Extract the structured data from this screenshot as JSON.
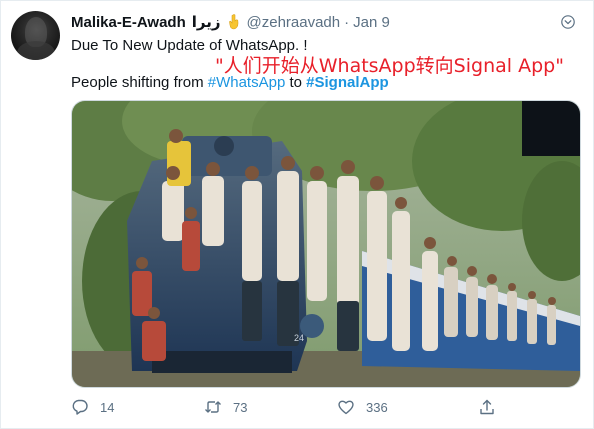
{
  "tweet": {
    "author_name": "Malika-E-Awadh",
    "author_name_urdu": "زیرا",
    "handle": "@zehraavadh",
    "separator": "·",
    "date": "Jan 9",
    "line1": "Due To New Update of WhatsApp. !",
    "annotation": "\"人们开始从WhatsApp转向Signal App\"",
    "line2_prefix": "People shifting from ",
    "hashtag1": "#WhatsApp",
    "line2_mid": " to ",
    "hashtag2": "#SignalApp"
  },
  "actions": {
    "reply_count": "14",
    "retweet_count": "73",
    "like_count": "336"
  },
  "icons": {
    "header": [
      "hand-icon",
      "chevron-down-icon"
    ],
    "actions": [
      "reply-icon",
      "retweet-icon",
      "like-icon",
      "share-icon"
    ]
  },
  "colors": {
    "link": "#1b95e0",
    "muted": "#5b7083",
    "annotation": "#e8202a",
    "text": "#0f1419"
  }
}
